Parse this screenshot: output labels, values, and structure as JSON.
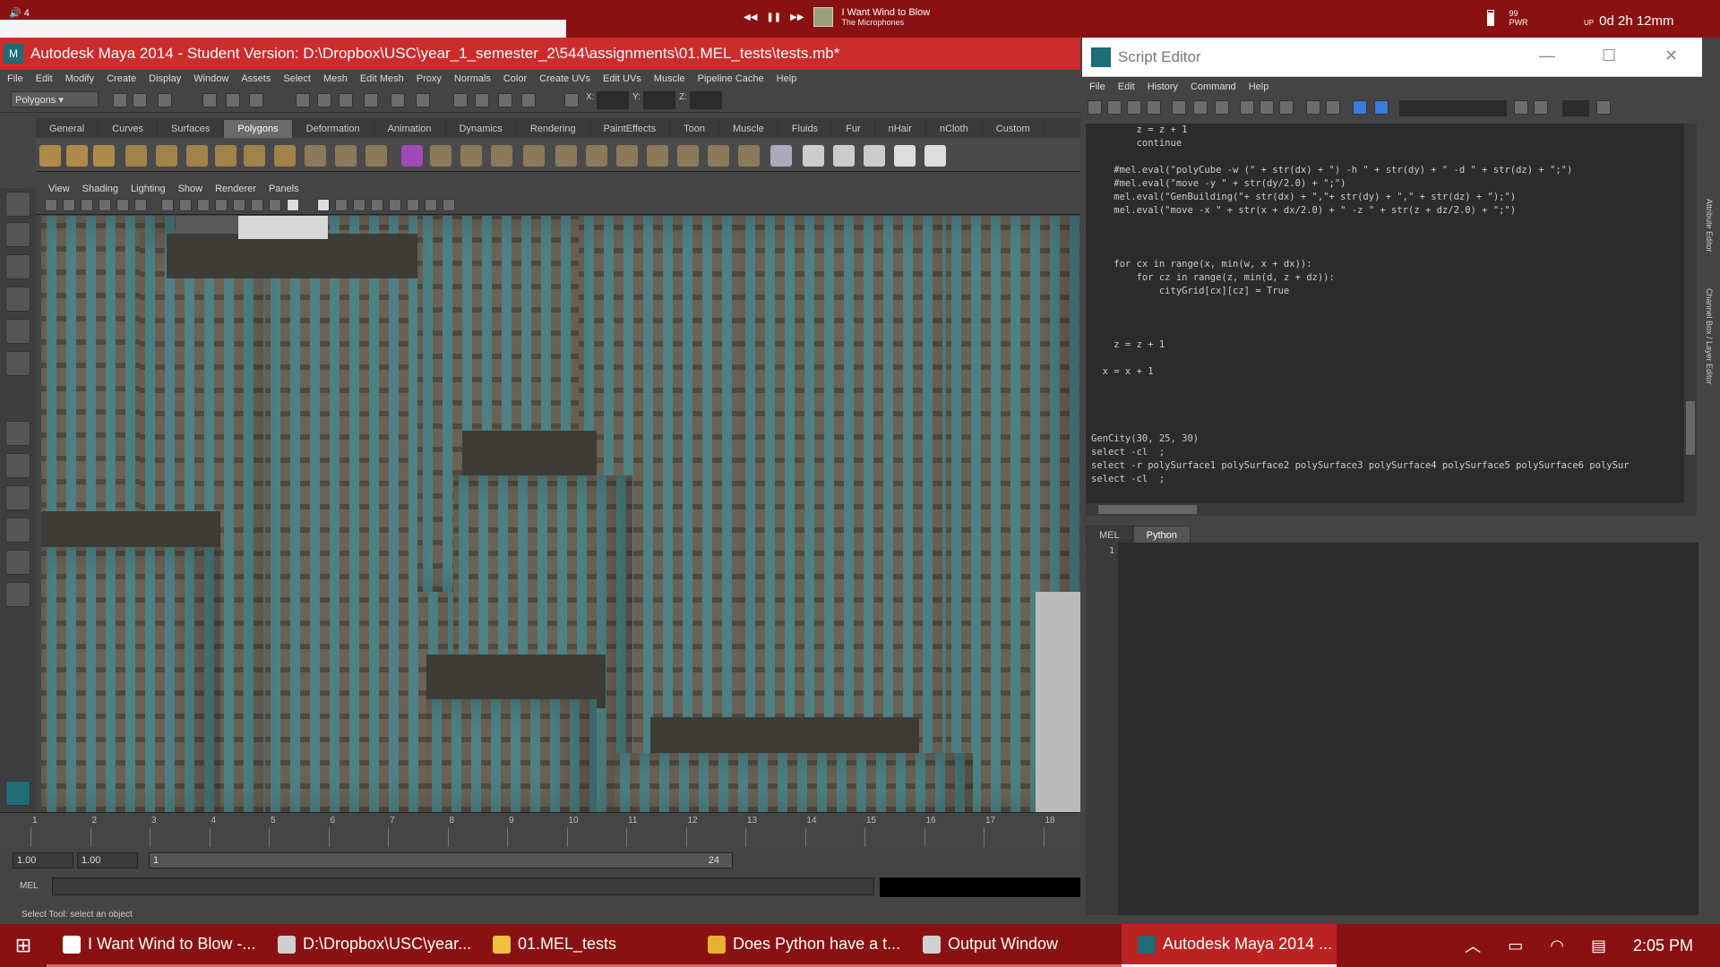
{
  "topbar": {
    "volume": "4",
    "media": {
      "prev": "◀◀",
      "pause": "❚❚",
      "next": "▶▶",
      "song": "I Want Wind to Blow",
      "artist": "The Microphones"
    },
    "battery": {
      "value": "99",
      "label": "PWR"
    },
    "uptime": {
      "prefix": "UP",
      "value": "0d 2h 12mm"
    }
  },
  "maya": {
    "title": "Autodesk Maya 2014 - Student Version: D:\\Dropbox\\USC\\year_1_semester_2\\544\\assignments\\01.MEL_tests\\tests.mb*",
    "menu": [
      "File",
      "Edit",
      "Modify",
      "Create",
      "Display",
      "Window",
      "Assets",
      "Select",
      "Mesh",
      "Edit Mesh",
      "Proxy",
      "Normals",
      "Color",
      "Create UVs",
      "Edit UVs",
      "Muscle",
      "Pipeline Cache",
      "Help"
    ],
    "mode": "Polygons",
    "xyz": {
      "x": "X:",
      "y": "Y:",
      "z": "Z:"
    },
    "shelf_tabs": [
      "General",
      "Curves",
      "Surfaces",
      "Polygons",
      "Deformation",
      "Animation",
      "Dynamics",
      "Rendering",
      "PaintEffects",
      "Toon",
      "Muscle",
      "Fluids",
      "Fur",
      "nHair",
      "nCloth",
      "Custom"
    ],
    "active_shelf": "Polygons",
    "viewport_menu": [
      "View",
      "Shading",
      "Lighting",
      "Show",
      "Renderer",
      "Panels"
    ],
    "timeline_ticks": [
      "1",
      "2",
      "3",
      "4",
      "5",
      "6",
      "7",
      "8",
      "9",
      "10",
      "11",
      "12",
      "13",
      "14",
      "15",
      "16",
      "17",
      "18"
    ],
    "range": {
      "start": "1.00",
      "start2": "1.00",
      "cur": "1",
      "end": "24"
    },
    "cmd_label": "MEL",
    "help_line": "Select Tool: select an object"
  },
  "script_editor": {
    "title": "Script Editor",
    "menu": [
      "File",
      "Edit",
      "History",
      "Command",
      "Help"
    ],
    "history": "        z = z + 1\n        continue\n\n    #mel.eval(\"polyCube -w (\" + str(dx) + \") -h \" + str(dy) + \" -d \" + str(dz) + \";\")\n    #mel.eval(\"move -y \" + str(dy/2.0) + \";\")\n    mel.eval(\"GenBuilding(\"+ str(dx) + \",\"+ str(dy) + \",\" + str(dz) + \");\")\n    mel.eval(\"move -x \" + str(x + dx/2.0) + \" -z \" + str(z + dz/2.0) + \";\")\n\n\n\n    for cx in range(x, min(w, x + dx)):\n        for cz in range(z, min(d, z + dz)):\n            cityGrid[cx][cz] = True\n\n\n\n    z = z + 1\n\n  x = x + 1\n\n\n\n\nGenCity(30, 25, 30)\nselect -cl  ;\nselect -r polySurface1 polySurface2 polySurface3 polySurface4 polySurface5 polySurface6 polySur\nselect -cl  ;",
    "tabs": [
      "MEL",
      "Python"
    ],
    "active_tab": "Python",
    "line_no": "1"
  },
  "dock_labels": [
    "Attribute Editor",
    "Channel Box / Layer Editor"
  ],
  "taskbar": {
    "items": [
      {
        "label": "I Want Wind to Blow -...",
        "icon": "music-icon",
        "color": "#ffffff"
      },
      {
        "label": "D:\\Dropbox\\USC\\year...",
        "icon": "window-icon",
        "color": "#cfcfcf"
      },
      {
        "label": "01.MEL_tests",
        "icon": "folder-icon",
        "color": "#f0c040"
      },
      {
        "label": "Does Python have a t...",
        "icon": "chrome-icon",
        "color": "#e8b030"
      },
      {
        "label": "Output Window",
        "icon": "output-window-icon",
        "color": "#d0d0d0"
      },
      {
        "label": "Autodesk Maya 2014 ...",
        "icon": "maya-icon",
        "color": "#1f6b76"
      }
    ],
    "active_index": 5,
    "clock": "2:05 PM"
  }
}
